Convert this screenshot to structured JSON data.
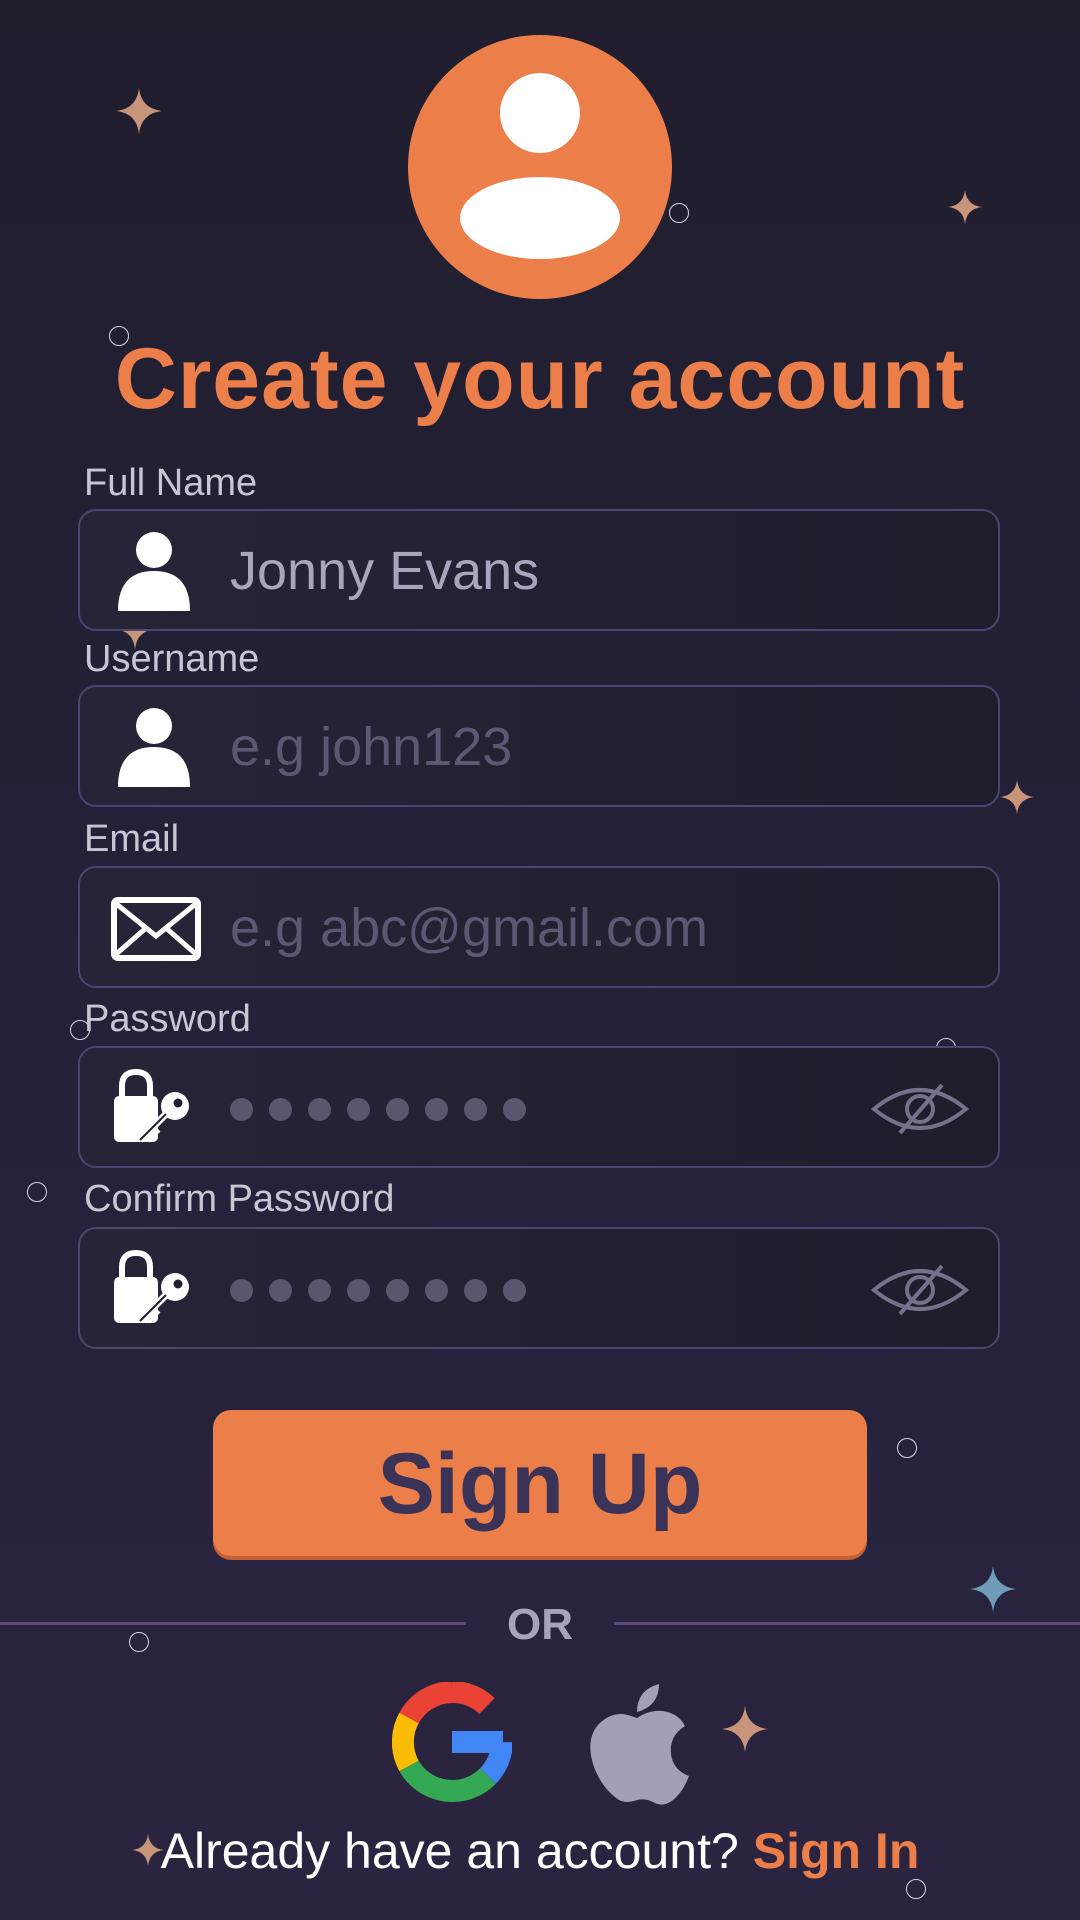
{
  "title": "Create your account",
  "colors": {
    "accent": "#ec7e4a",
    "background": "#201e2d",
    "button_text": "#3b3357"
  },
  "fields": {
    "full_name": {
      "label": "Full Name",
      "value": "Jonny Evans",
      "placeholder": "",
      "icon": "user-icon"
    },
    "username": {
      "label": "Username",
      "value": "",
      "placeholder": "e.g john123",
      "icon": "user-icon"
    },
    "email": {
      "label": "Email",
      "value": "",
      "placeholder": "e.g abc@gmail.com",
      "icon": "envelope-icon"
    },
    "password": {
      "label": "Password",
      "masked_length": 8,
      "icon": "lock-key-icon",
      "toggle_icon": "eye-off-icon"
    },
    "confirm_password": {
      "label": "Confirm Password",
      "masked_length": 8,
      "icon": "lock-key-icon",
      "toggle_icon": "eye-off-icon"
    }
  },
  "signup_button": "Sign Up",
  "divider_text": "OR",
  "social": [
    {
      "name": "Google",
      "icon": "google-icon"
    },
    {
      "name": "Apple",
      "icon": "apple-icon"
    }
  ],
  "footer": {
    "prompt": "Already have an account?",
    "link": "Sign In"
  }
}
